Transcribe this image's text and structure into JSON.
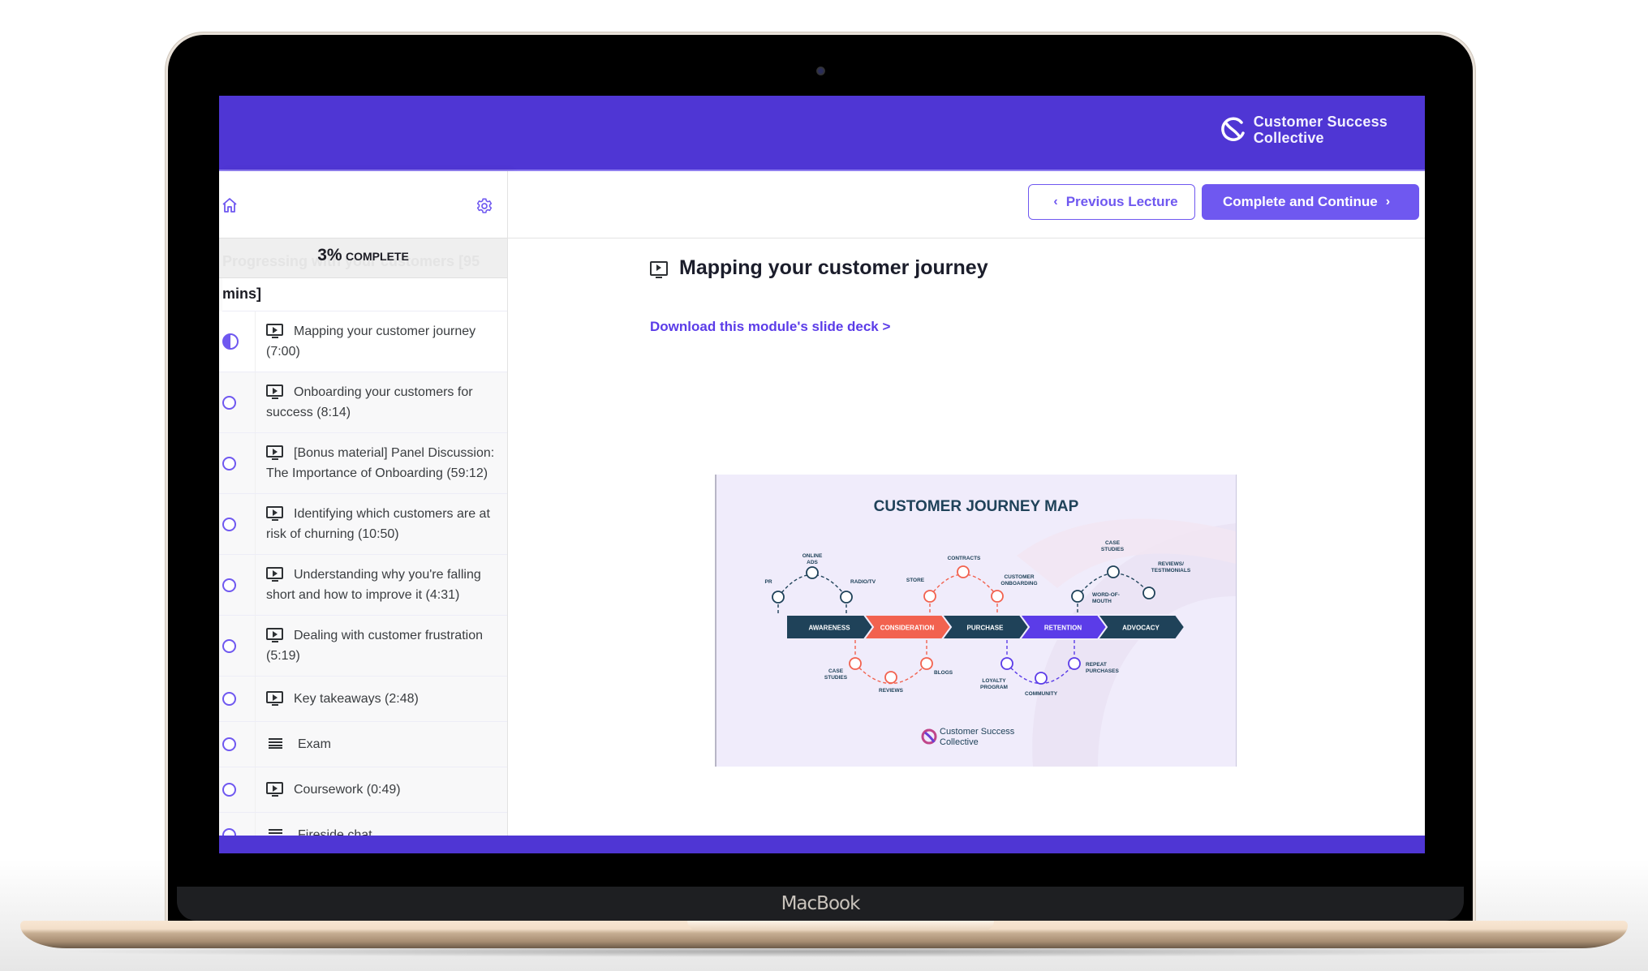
{
  "device": {
    "label": "MacBook"
  },
  "brand": {
    "line1": "Customer Success",
    "line2": "Collective"
  },
  "colors": {
    "primary": "#4f36d4",
    "accent": "#6f58f0",
    "link": "#5b3ce8",
    "navy": "#1f4259",
    "coral": "#f2624f",
    "violet": "#5b3ce8"
  },
  "sidebar": {
    "home_icon": "home-icon",
    "settings_icon": "gear-icon",
    "progress_percent": "3%",
    "progress_label": "COMPLETE",
    "section_title": "Progressing with your customers [95",
    "section_title_tail": "mins]",
    "items": [
      {
        "type": "video",
        "label": "Mapping your customer journey (7:00)",
        "status": "in-progress"
      },
      {
        "type": "video",
        "label": "Onboarding your customers for success (8:14)",
        "status": "incomplete"
      },
      {
        "type": "video",
        "label": "[Bonus material] Panel Discussion: The Importance of Onboarding (59:12)",
        "status": "incomplete"
      },
      {
        "type": "video",
        "label": "Identifying which customers are at risk of churning (10:50)",
        "status": "incomplete"
      },
      {
        "type": "video",
        "label": "Understanding why you're falling short and how to improve it (4:31)",
        "status": "incomplete"
      },
      {
        "type": "video",
        "label": "Dealing with customer frustration (5:19)",
        "status": "incomplete"
      },
      {
        "type": "video",
        "label": "Key takeaways (2:48)",
        "status": "incomplete"
      },
      {
        "type": "text",
        "label": "Exam",
        "status": "incomplete"
      },
      {
        "type": "video",
        "label": "Coursework (0:49)",
        "status": "incomplete"
      },
      {
        "type": "text",
        "label": "Fireside chat",
        "status": "incomplete"
      }
    ]
  },
  "toolbar": {
    "previous_label": "Previous Lecture",
    "next_label": "Complete and Continue"
  },
  "lecture": {
    "title": "Mapping your customer journey",
    "download_link": "Download this module's slide deck >"
  },
  "slide": {
    "title": "CUSTOMER JOURNEY MAP",
    "stages": [
      "AWARENESS",
      "CONSIDERATION",
      "PURCHASE",
      "RETENTION",
      "ADVOCACY"
    ],
    "touchpoints": {
      "awareness": [
        "PR",
        "ONLINE ADS",
        "RADIO/TV"
      ],
      "consideration_above": [
        "STORE",
        "CONTRACTS",
        "CUSTOMER ONBOARDING"
      ],
      "consideration_below": [
        "CASE STUDIES",
        "REVIEWS",
        "BLOGS"
      ],
      "retention_below": [
        "LOYALTY PROGRAM",
        "COMMUNITY",
        "REPEAT PURCHASES"
      ],
      "advocacy_above": [
        "WORD-OF- MOUTH",
        "CASE STUDIES",
        "REVIEWS/ TESTIMONIALS"
      ]
    },
    "footer_brand_line1": "Customer Success",
    "footer_brand_line2": "Collective"
  }
}
